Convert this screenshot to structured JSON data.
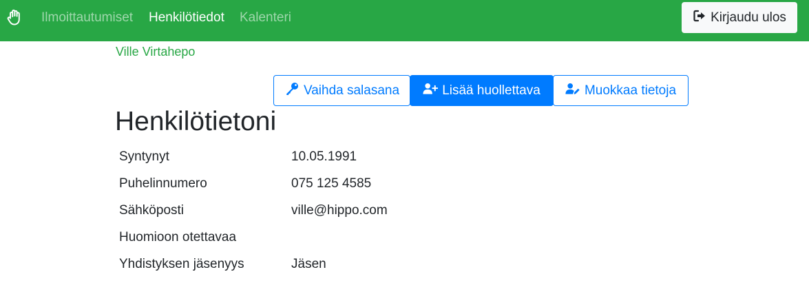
{
  "navbar": {
    "brand_icon": "hand-icon",
    "color": "#28a745",
    "links": [
      {
        "label": "Ilmoittautumiset",
        "active": false
      },
      {
        "label": "Henkilötiedot",
        "active": true
      },
      {
        "label": "Kalenteri",
        "active": false
      }
    ],
    "logout_label": "Kirjaudu ulos",
    "logout_icon": "sign-out-icon"
  },
  "user": {
    "name": "Ville Virtahepo"
  },
  "actions": {
    "change_password": {
      "label": "Vaihda salasana",
      "icon": "key-icon"
    },
    "add_dependent": {
      "label": "Lisää huollettava",
      "icon": "user-plus-icon"
    },
    "edit_info": {
      "label": "Muokkaa tietoja",
      "icon": "user-edit-icon"
    },
    "accent_color": "#007bff"
  },
  "page": {
    "title": "Henkilötietoni"
  },
  "info": {
    "rows": [
      {
        "label": "Syntynyt",
        "value": "10.05.1991"
      },
      {
        "label": "Puhelinnumero",
        "value": "075 125 4585"
      },
      {
        "label": "Sähköposti",
        "value": "ville@hippo.com"
      },
      {
        "label": "Huomioon otettavaa",
        "value": ""
      },
      {
        "label": "Yhdistyksen jäsenyys",
        "value": "Jäsen"
      }
    ]
  }
}
